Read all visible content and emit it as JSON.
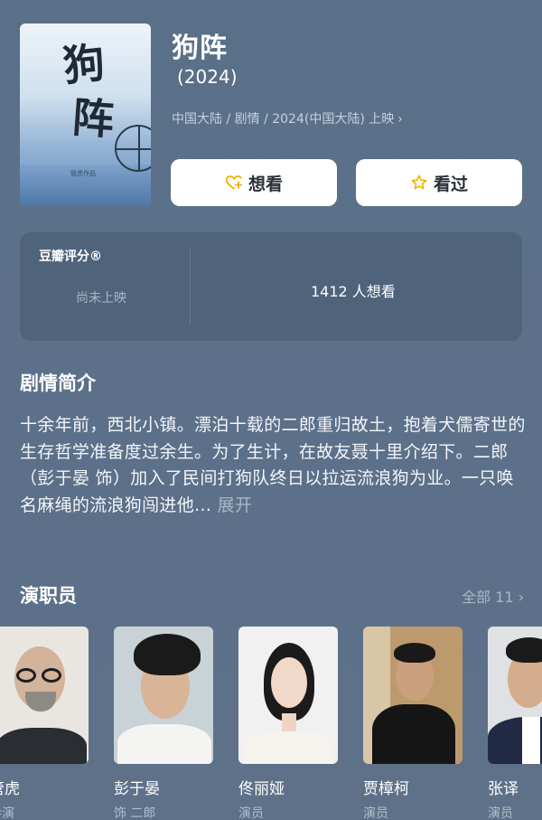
{
  "movie": {
    "title": "狗阵",
    "year": "(2024)",
    "meta": "中国大陆 / 剧情 / 2024(中国大陆) 上映",
    "meta_chevron": "›",
    "poster_title_1": "狗",
    "poster_title_2": "阵",
    "poster_credit": "管虎作品"
  },
  "actions": {
    "want_label": "想看",
    "seen_label": "看过",
    "accent": "#f2b100"
  },
  "rating": {
    "label": "豆瓣评分®",
    "status": "尚未上映",
    "want_count": "1412 人想看"
  },
  "synopsis": {
    "heading": "剧情简介",
    "text": "十余年前，西北小镇。漂泊十载的二郎重归故土，抱着犬儒寄世的生存哲学准备度过余生。为了生计，在故友聂十里介绍下。二郎（彭于晏 饰）加入了民间打狗队终日以拉运流浪狗为业。一只唤名麻绳的流浪狗闯进他…",
    "expand": "展开"
  },
  "cast": {
    "heading": "演职员",
    "all_label": "全部 11 ›",
    "members": [
      {
        "name": "管虎",
        "role": "导演"
      },
      {
        "name": "彭于晏",
        "role": "饰 二郎"
      },
      {
        "name": "佟丽娅",
        "role": "演员"
      },
      {
        "name": "贾樟柯",
        "role": "演员"
      },
      {
        "name": "张译",
        "role": "演员"
      }
    ]
  }
}
